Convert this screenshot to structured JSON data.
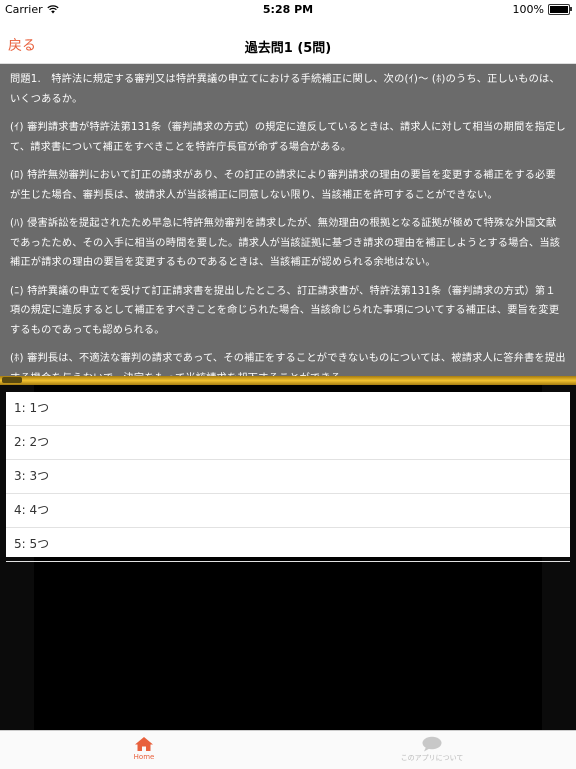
{
  "status_bar": {
    "carrier": "Carrier",
    "time": "5:28 PM",
    "battery": "100%",
    "battery_level": 1.0
  },
  "nav": {
    "back_label": "戻る",
    "title": "過去問1 (5問)"
  },
  "question": {
    "paragraphs": [
      "問題1.　特許法に規定する審判又は特許異議の申立てにおける手続補正に関し、次の(ｲ)～ (ﾎ)のうち、正しいものは、いくつあるか。",
      "(ｲ) 審判請求書が特許法第131条（審判請求の方式）の規定に違反しているときは、請求人に対して相当の期間を指定して、請求書について補正をすべきことを特許庁長官が命ずる場合がある。",
      "(ﾛ) 特許無効審判において訂正の請求があり、その訂正の請求により審判請求の理由の要旨を変更する補正をする必要が生じた場合、審判長は、被請求人が当該補正に同意しない限り、当該補正を許可することができない。",
      "(ﾊ) 侵害訴訟を提起されたため早急に特許無効審判を請求したが、無効理由の根拠となる証拠が極めて特殊な外国文献であったため、その入手に相当の時間を要した。請求人が当該証拠に基づき請求の理由を補正しようとする場合、当該補正が請求の理由の要旨を変更するものであるときは、当該補正が認められる余地はない。",
      "(ﾆ) 特許異議の申立てを受けて訂正請求書を提出したところ、訂正請求書が、特許法第131条（審判請求の方式）第１項の規定に違反するとして補正をすべきことを命じられた場合、当該命じられた事項についてする補正は、要旨を変更するものであっても認められる。",
      "(ﾎ) 審判長は、不適法な審判の請求であって、その補正をすることができないものについては、被請求人に答弁書を提出する機会を与えないで、決定をもって当該請求を却下することができる。"
    ]
  },
  "choices": [
    "1: 1つ",
    "2: 2つ",
    "3: 3つ",
    "4: 4つ",
    "5: 5つ"
  ],
  "tabs": {
    "home": "Home",
    "about": "このアプリについて"
  },
  "colors": {
    "accent": "#e8603c",
    "panel": "#6b6b6b",
    "gold": "#f2c230"
  }
}
